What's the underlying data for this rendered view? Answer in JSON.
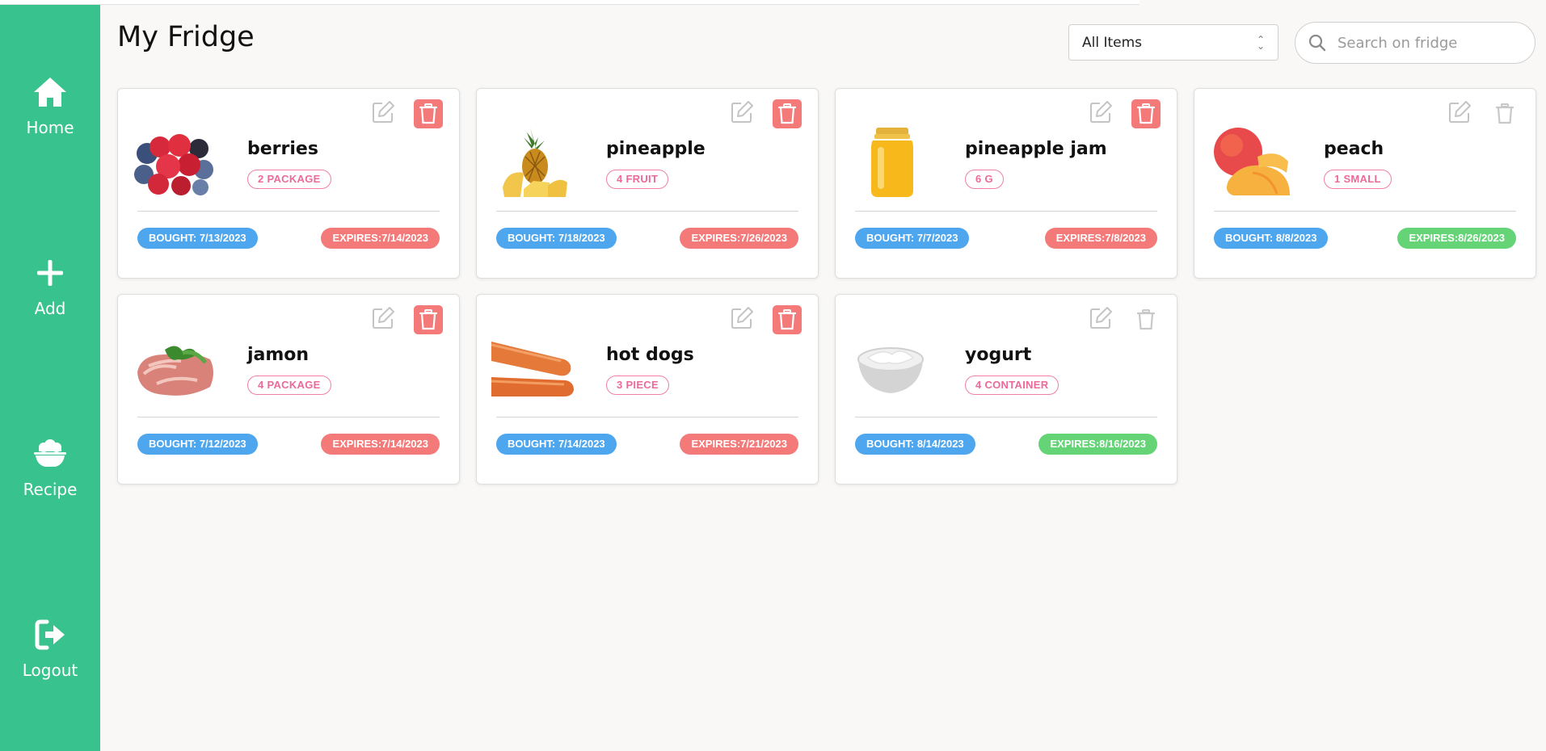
{
  "page_title": "My Fridge",
  "sidebar": {
    "items": [
      {
        "label": "Home",
        "icon": "home-icon"
      },
      {
        "label": "Add",
        "icon": "plus-icon"
      },
      {
        "label": "Recipe",
        "icon": "bowl-icon"
      },
      {
        "label": "Logout",
        "icon": "logout-icon"
      }
    ]
  },
  "filter": {
    "selected": "All Items"
  },
  "search": {
    "placeholder": "Search on fridge",
    "value": ""
  },
  "colors": {
    "sidebar": "#37c28e",
    "bought_badge": "#4da6ee",
    "expired_badge": "#f47a7a",
    "fresh_badge": "#64d477",
    "quantity_outline": "#ec6a99",
    "delete_active": "#f47a7a"
  },
  "items": [
    {
      "name": "berries",
      "quantity": "2 PACKAGE",
      "bought": "BOUGHT: 7/13/2023",
      "expires": "EXPIRES:7/14/2023",
      "status": "expired",
      "image": "berries-image"
    },
    {
      "name": "pineapple",
      "quantity": "4 FRUIT",
      "bought": "BOUGHT: 7/18/2023",
      "expires": "EXPIRES:7/26/2023",
      "status": "expired",
      "image": "pineapple-image"
    },
    {
      "name": "pineapple jam",
      "quantity": "6 G",
      "bought": "BOUGHT: 7/7/2023",
      "expires": "EXPIRES:7/8/2023",
      "status": "expired",
      "image": "jam-jar-image"
    },
    {
      "name": "peach",
      "quantity": "1 SMALL",
      "bought": "BOUGHT: 8/8/2023",
      "expires": "EXPIRES:8/26/2023",
      "status": "fresh",
      "image": "peach-image"
    },
    {
      "name": "jamon",
      "quantity": "4 PACKAGE",
      "bought": "BOUGHT: 7/12/2023",
      "expires": "EXPIRES:7/14/2023",
      "status": "expired",
      "image": "jamon-image"
    },
    {
      "name": "hot dogs",
      "quantity": "3 PIECE",
      "bought": "BOUGHT: 7/14/2023",
      "expires": "EXPIRES:7/21/2023",
      "status": "expired",
      "image": "hot-dogs-image"
    },
    {
      "name": "yogurt",
      "quantity": "4 CONTAINER",
      "bought": "BOUGHT: 8/14/2023",
      "expires": "EXPIRES:8/16/2023",
      "status": "fresh",
      "image": "yogurt-image"
    }
  ]
}
